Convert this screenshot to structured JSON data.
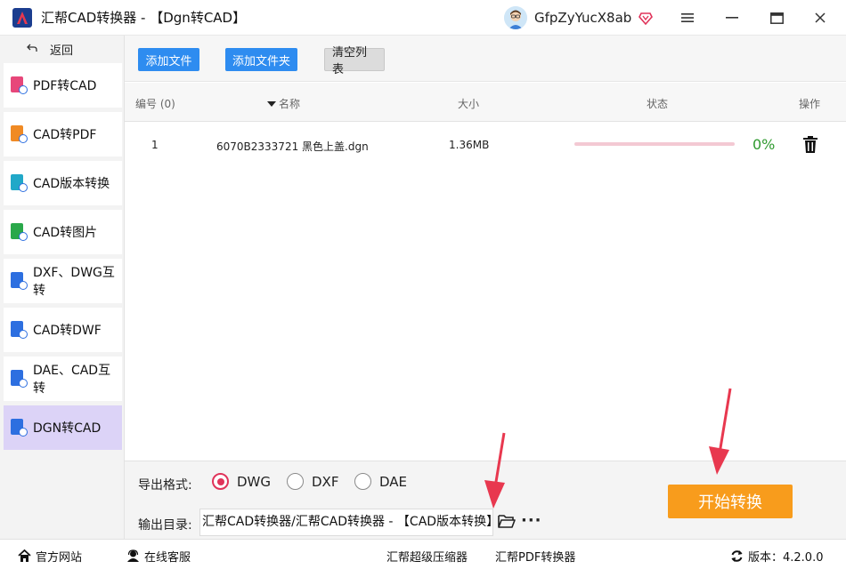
{
  "window": {
    "title": "汇帮CAD转换器 - 【Dgn转CAD】",
    "username": "GfpZyYucX8ab",
    "buttons": [
      "menu-icon",
      "minimize-icon",
      "maximize-icon",
      "close-icon"
    ]
  },
  "sidebar": {
    "back_label": "返回",
    "items": [
      {
        "label": "PDF转CAD",
        "icon": "pdf-to-cad-icon",
        "color": "#e7477a"
      },
      {
        "label": "CAD转PDF",
        "icon": "cad-to-pdf-icon",
        "color": "#f08a24"
      },
      {
        "label": "CAD版本转换",
        "icon": "cad-version-icon",
        "color": "#21a8c8"
      },
      {
        "label": "CAD转图片",
        "icon": "cad-to-image-icon",
        "color": "#2aa84a"
      },
      {
        "label": "DXF、DWG互转",
        "icon": "dxf-dwg-icon",
        "color": "#2d6fe0"
      },
      {
        "label": "CAD转DWF",
        "icon": "cad-to-dwf-icon",
        "color": "#2d6fe0"
      },
      {
        "label": "DAE、CAD互转",
        "icon": "dae-cad-icon",
        "color": "#2d6fe0"
      },
      {
        "label": "DGN转CAD",
        "icon": "dgn-to-cad-icon",
        "color": "#2d6fe0"
      }
    ],
    "active_index": 7
  },
  "toolbar": {
    "add_file": "添加文件",
    "add_folder": "添加文件夹",
    "clear_list": "清空列表"
  },
  "table": {
    "headers": {
      "index": "编号 (0)",
      "name": "名称",
      "size": "大小",
      "status": "状态",
      "action": "操作"
    },
    "rows": [
      {
        "index": "1",
        "name": "6070B2333721 黑色上盖.dgn",
        "size": "1.36MB",
        "progress": 0,
        "percent": "0%"
      }
    ]
  },
  "settings": {
    "format_label": "导出格式:",
    "formats": [
      "DWG",
      "DXF",
      "DAE"
    ],
    "selected_format": "DWG",
    "output_label": "输出目录:",
    "output_path": "汇帮CAD转换器/汇帮CAD转换器 - 【CAD版本转换】",
    "start_button": "开始转换"
  },
  "statusbar": {
    "website": "官方网站",
    "support": "在线客服",
    "compressor": "汇帮超级压缩器",
    "pdf_converter": "汇帮PDF转换器",
    "version": "版本：4.2.0.0"
  },
  "colors": {
    "accent_blue": "#2e8cf0",
    "start_orange": "#f89c1c",
    "radio_red": "#e0335a",
    "active_sidebar": "#dcd3f7",
    "annotation_arrow": "#e8384f"
  }
}
